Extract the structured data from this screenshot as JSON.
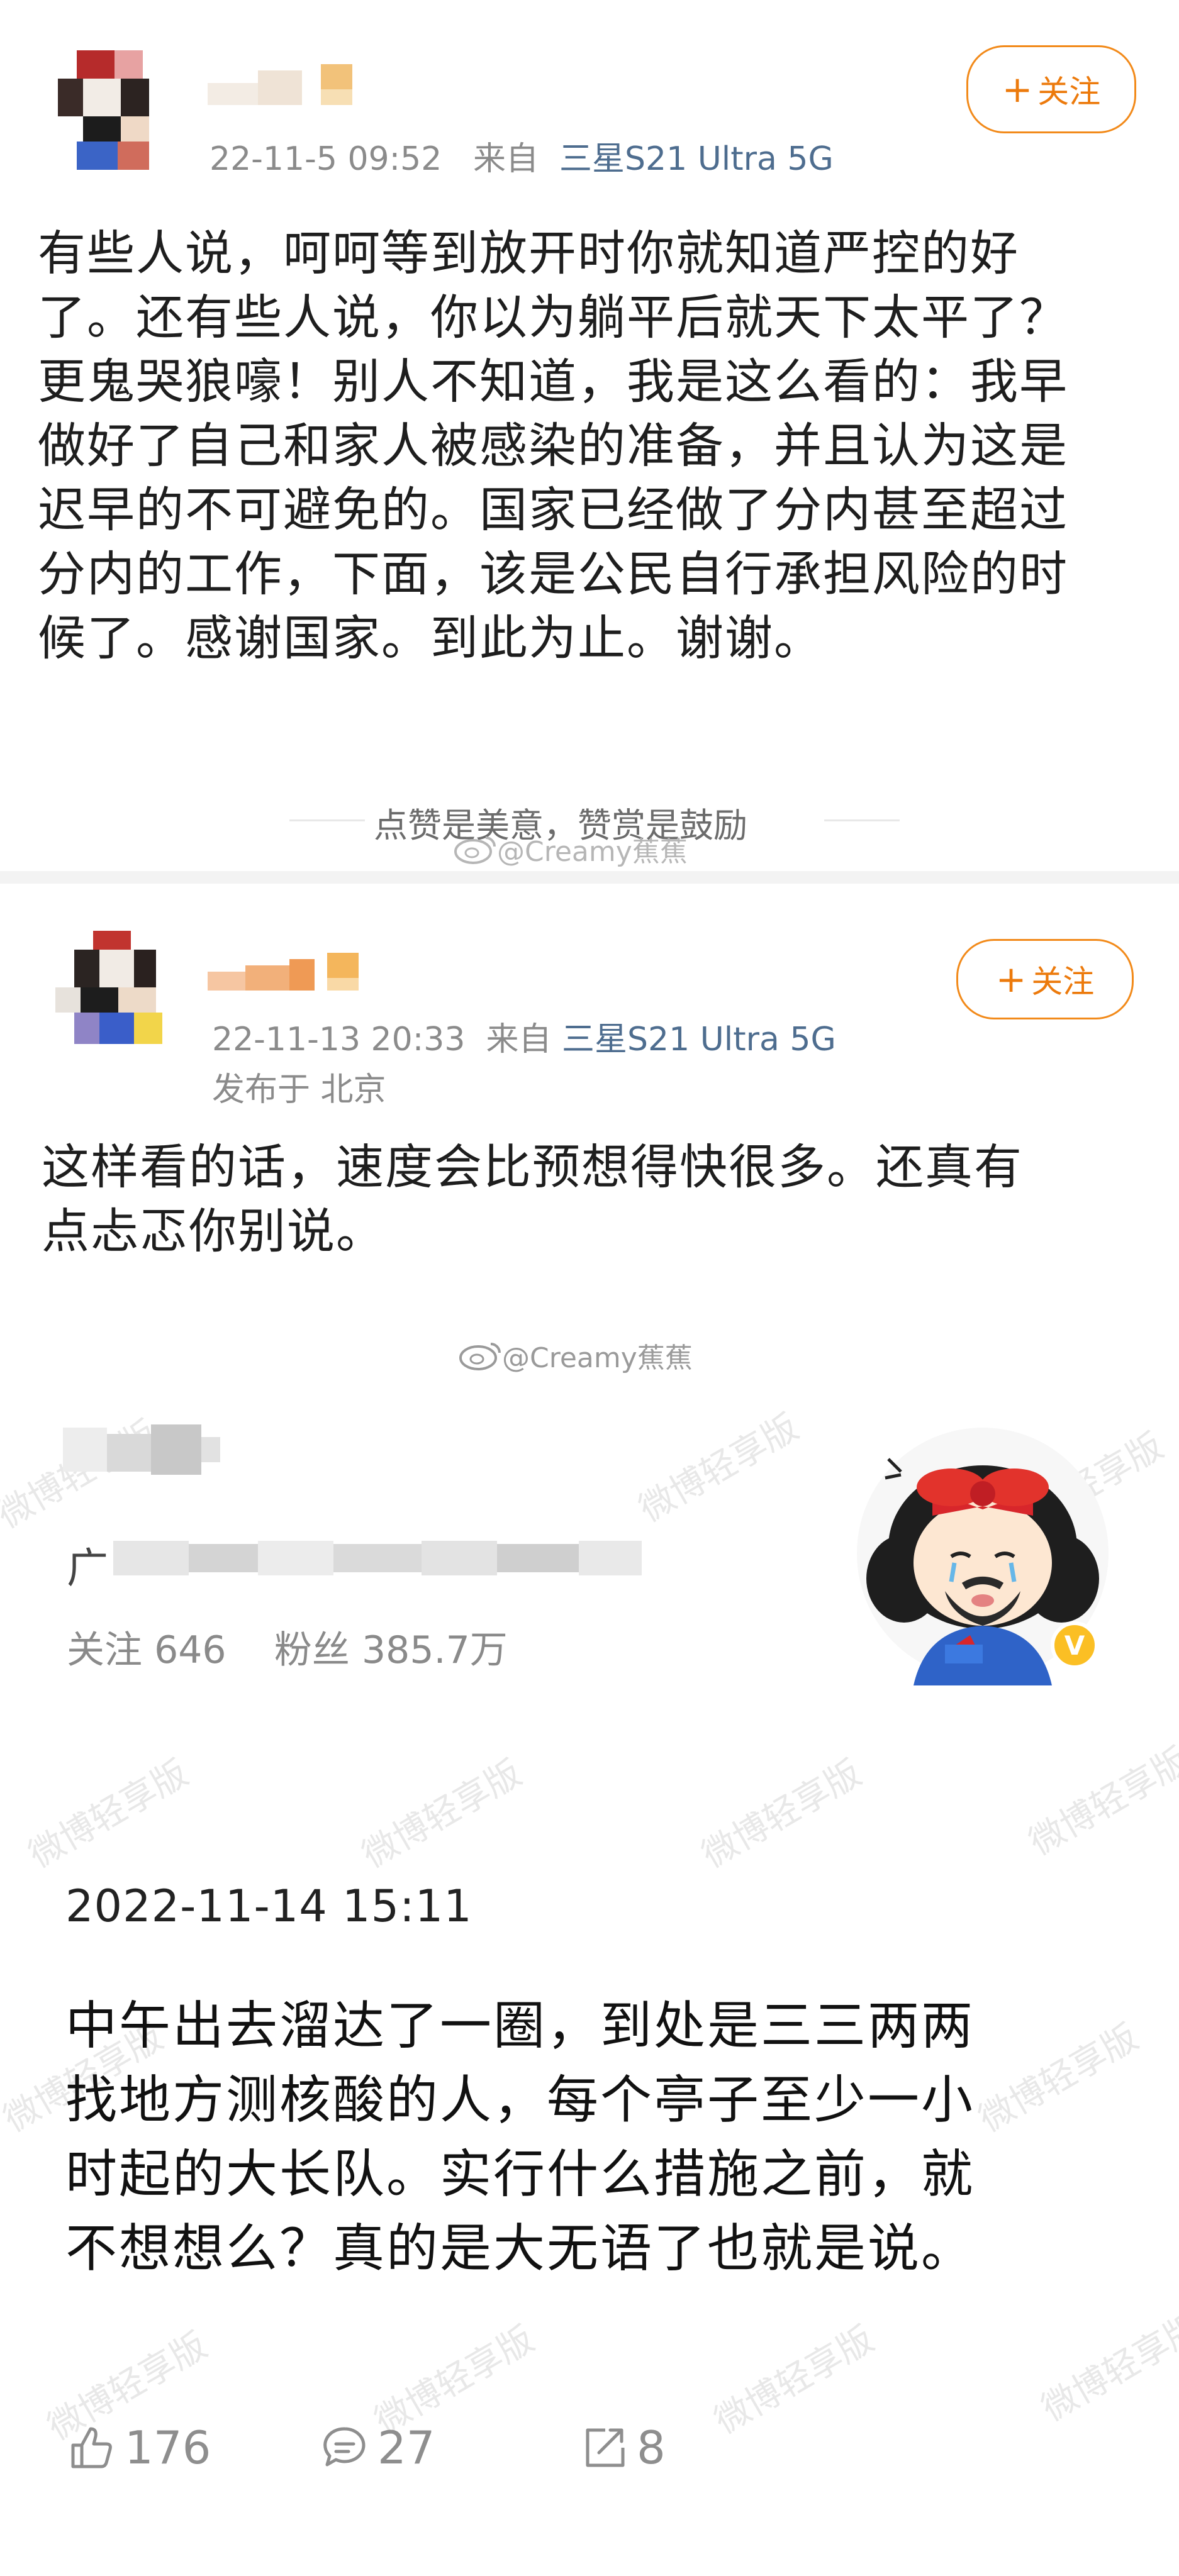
{
  "post1": {
    "timestamp": "22-11-5 09:52",
    "source_prefix": "来自",
    "device": "三星S21 Ultra 5G",
    "follow_plus": "+",
    "follow_label": "关注",
    "lines": [
      "有些人说，呵呵等到放开时你就知道严控的好",
      "了。还有些人说，你以为躺平后就天下太平了？",
      "更鬼哭狼嚎！别人不知道，我是这么看的：我早",
      "做好了自己和家人被感染的准备，并且认为这是",
      "迟早的不可避免的。国家已经做了分内甚至超过",
      "分内的工作，下面，该是公民自行承担风险的时",
      "候了。感谢国家。到此为止。谢谢。"
    ],
    "reward_text": "点赞是美意，赞赏是鼓励",
    "watermark": "@Creamy蕉蕉"
  },
  "post2": {
    "timestamp": "22-11-13 20:33",
    "source_prefix": "来自",
    "device": "三星S21 Ultra 5G",
    "location": "发布于 北京",
    "follow_plus": "+",
    "follow_label": "关注",
    "lines": [
      "这样看的话，速度会比预想得快很多。还真有",
      "点忐忑你别说。"
    ],
    "watermark": "@Creamy蕉蕉"
  },
  "profile": {
    "location_prefix": "广",
    "follow_label": "关注",
    "follow_count": "646",
    "fans_label": "粉丝",
    "fans_count": "385.7万",
    "verified_mark": "V"
  },
  "post3": {
    "timestamp": "2022-11-14 15:11",
    "lines": [
      "中午出去溜达了一圈，到处是三三两两",
      "找地方测核酸的人，每个亭子至少一小",
      "时起的大长队。实行什么措施之前，就",
      "不想想么？真的是大无语了也就是说。"
    ],
    "likes": "176",
    "comments": "27",
    "reposts": "8",
    "watermark_text": "微博轻享版"
  },
  "icons": [
    "like-icon",
    "comment-icon",
    "repost-icon",
    "weibo-logo-icon",
    "plus-icon"
  ],
  "colors": {
    "accent": "#ec7a0c",
    "device_link": "#4e6d8f",
    "meta": "#8b8b8b",
    "text": "#1e1e1e"
  }
}
